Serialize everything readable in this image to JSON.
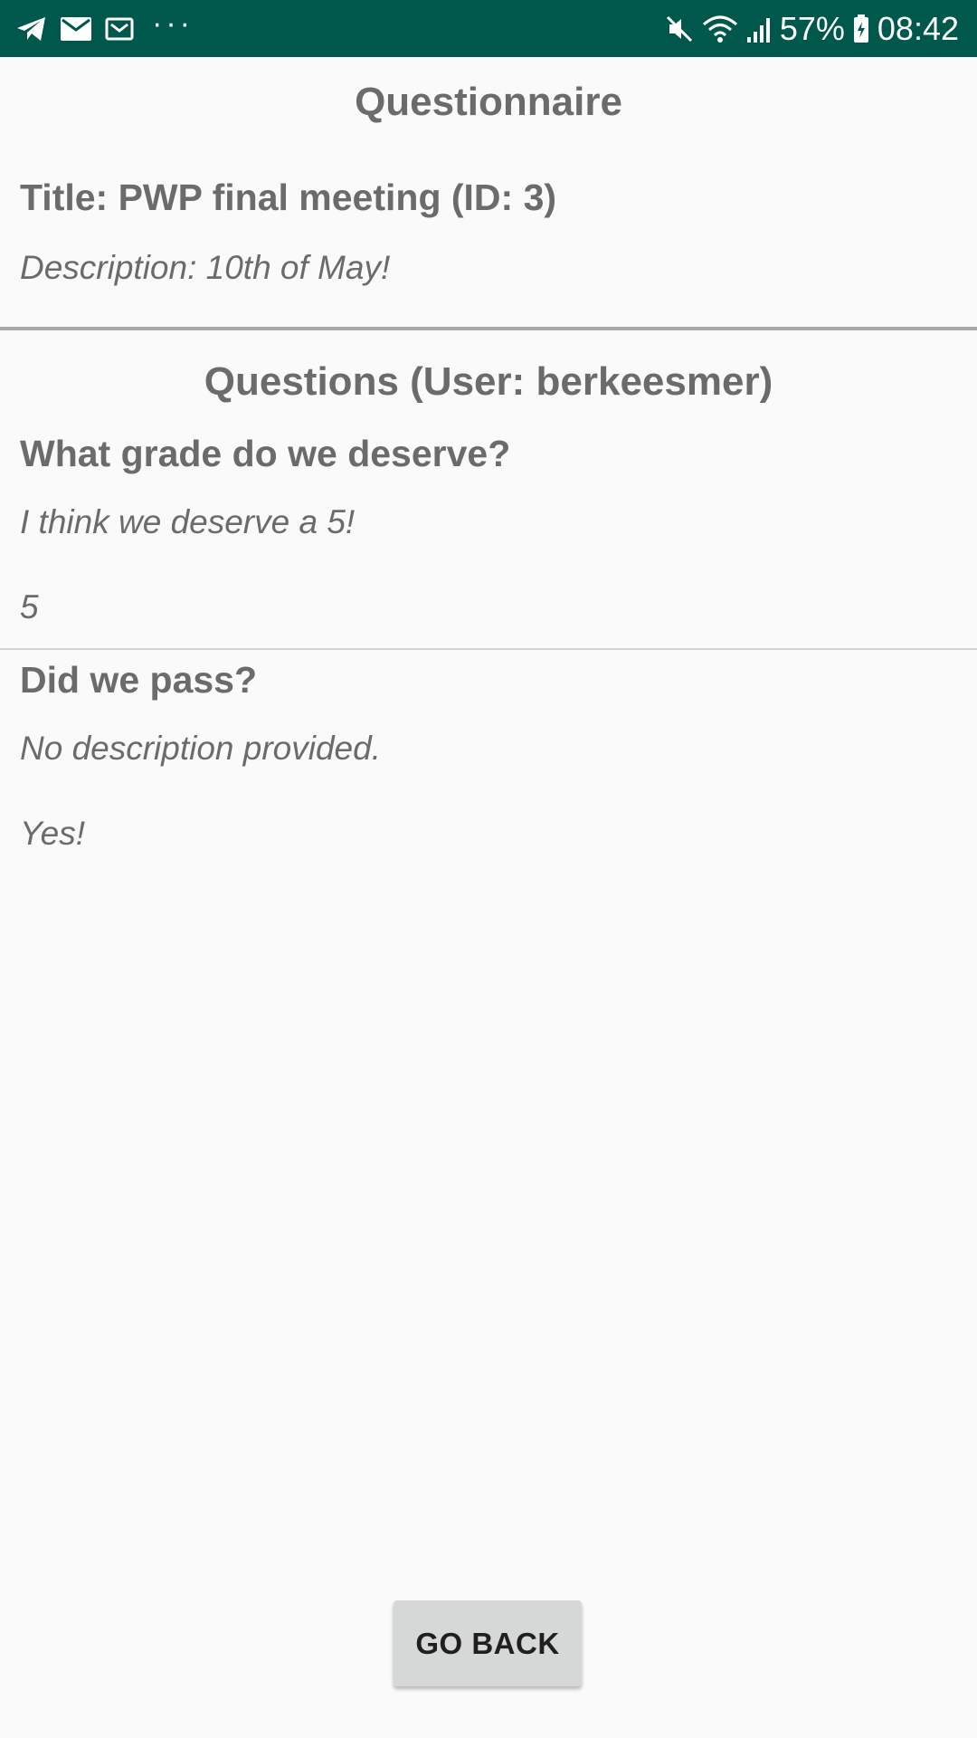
{
  "status_bar": {
    "icons_left": [
      "telegram-icon",
      "mail-icon",
      "mail-icon",
      "more-dots-icon"
    ],
    "dots": "···",
    "icons_right": [
      "mute-icon",
      "wifi-icon",
      "signal-icon",
      "battery-icon"
    ],
    "battery": "57%",
    "time": "08:42",
    "background_color": "#00574b"
  },
  "header": {
    "title": "Questionnaire"
  },
  "questionnaire": {
    "title": "Title: PWP final meeting (ID: 3)",
    "description": "Description: 10th of May!"
  },
  "questions_header": "Questions (User: berkeesmer)",
  "questions": [
    {
      "text": "What grade do we deserve?",
      "description": "I think we deserve a 5!",
      "answer": "5"
    },
    {
      "text": "Did we pass?",
      "description": "No description provided.",
      "answer": "Yes!"
    }
  ],
  "actions": {
    "go_back_label": "GO BACK"
  }
}
